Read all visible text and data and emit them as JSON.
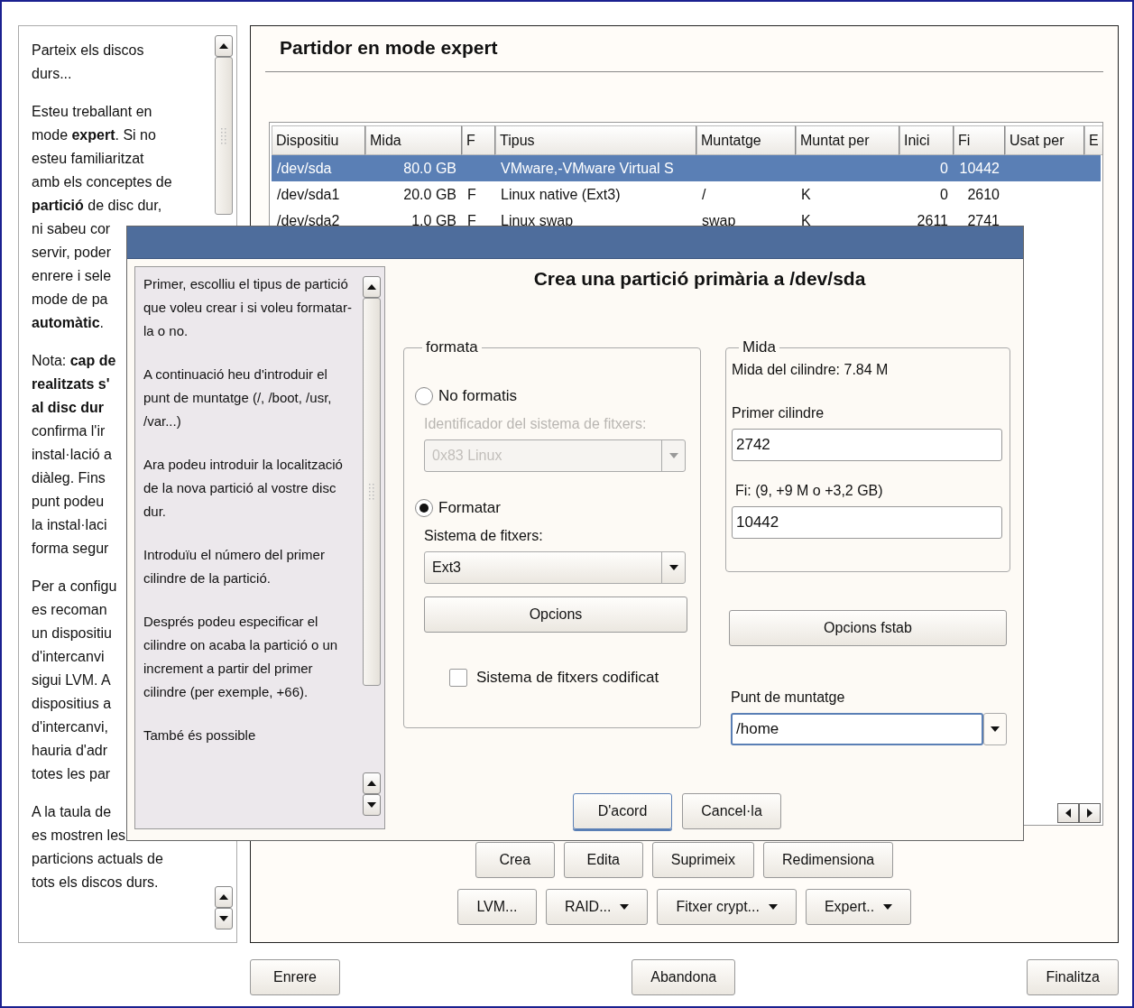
{
  "help_panel": {
    "paragraphs": [
      [
        "Parteix els discos",
        "durs..."
      ],
      [
        "Esteu treballant en",
        "mode **expert**. Si no",
        "esteu familiaritzat",
        "amb els conceptes de",
        "**partició** de disc dur,",
        "ni sabeu cor",
        "servir, poder",
        "enrere i sele",
        "mode de pa",
        "**automàtic**."
      ],
      [
        "Nota: **cap de**",
        "**realitzats s'**",
        "**al disc dur**",
        "confirma l'ir",
        "instal·lació a",
        "diàleg. Fins",
        "punt podeu",
        "la instal·laci",
        "forma segur"
      ],
      [
        "Per a configu",
        "es recoman",
        "un dispositiu",
        "d'intercanvi",
        "sigui LVM. A",
        "dispositius a",
        "d'intercanvi,",
        "hauria d'adr",
        "totes les par"
      ],
      [
        "A la taula de",
        "es mostren les",
        "particions actuals de",
        "tots els discos durs."
      ]
    ]
  },
  "main": {
    "title": "Partidor en mode expert",
    "table": {
      "columns": [
        "Dispositiu",
        "Mida",
        "F",
        "Tipus",
        "Muntatge",
        "Muntat per",
        "Inici",
        "Fi",
        "Usat per",
        "E"
      ],
      "rows": [
        {
          "selected": true,
          "device": "/dev/sda",
          "size": "80.0 GB",
          "type": "VMware,-VMware Virtual S",
          "start": "0",
          "end": "10442"
        },
        {
          "selected": false,
          "device": "/dev/sda1",
          "size": "20.0 GB",
          "f": "F",
          "type": "Linux native (Ext3)",
          "mount": "/",
          "mounted_by": "K",
          "start": "0",
          "end": "2610"
        },
        {
          "selected": false,
          "device": "/dev/sda2",
          "size": "1.0 GB",
          "f": "F",
          "type": "Linux swap",
          "mount": "swap",
          "mounted_by": "K",
          "start": "2611",
          "end": "2741"
        }
      ]
    },
    "action_rows": [
      [
        {
          "label": "Crea",
          "menu": false
        },
        {
          "label": "Edita",
          "menu": false
        },
        {
          "label": "Suprimeix",
          "menu": false
        },
        {
          "label": "Redimensiona",
          "menu": false
        }
      ],
      [
        {
          "label": "LVM...",
          "menu": false
        },
        {
          "label": "RAID...",
          "menu": true
        },
        {
          "label": "Fitxer crypt...",
          "menu": true
        },
        {
          "label": "Expert..",
          "menu": true
        }
      ]
    ]
  },
  "footer_buttons": [
    "Enrere",
    "Abandona",
    "Finalitza"
  ],
  "dialog": {
    "heading": "Crea una partició primària a /dev/sda",
    "help": [
      "Primer, escolliu el tipus de partició que voleu crear i si voleu formatar-la o no.",
      "A continuació heu d'introduir el punt de muntatge (/, /boot, /usr, /var...)",
      "Ara podeu introduir la localització de la nova partició al vostre disc dur.",
      "Introduïu el número del primer cilindre de la partició.",
      "Després podeu especificar el cilindre on acaba la partició o un increment a partir del primer cilindre (per exemple, +66).",
      "També és possible"
    ],
    "format_group": {
      "title": "formata",
      "options": [
        {
          "label": "No formatis",
          "selected": false,
          "field_label": "Identificador del sistema de fitxers:",
          "field_value": "0x83 Linux",
          "disabled": true
        },
        {
          "label": "Formatar",
          "selected": true,
          "field_label": "Sistema de fitxers:",
          "field_value": "Ext3",
          "disabled": false
        }
      ],
      "options_button": "Opcions",
      "encrypt": {
        "label": "Sistema de fitxers codificat",
        "checked": false
      }
    },
    "size_group": {
      "title": "Mida",
      "cylinder_size": "Mida del cilindre: 7.84 M",
      "start_label": "Primer cilindre",
      "start_value": "2742",
      "end_label": "Fi: (9, +9 M o +3,2 GB)",
      "end_value": "10442"
    },
    "fstab_button": "Opcions fstab",
    "mount": {
      "label": "Punt de muntatge",
      "value": "/home"
    },
    "buttons": [
      {
        "label": "D'acord",
        "default": true
      },
      {
        "label": "Cancel·la",
        "default": false
      }
    ]
  }
}
